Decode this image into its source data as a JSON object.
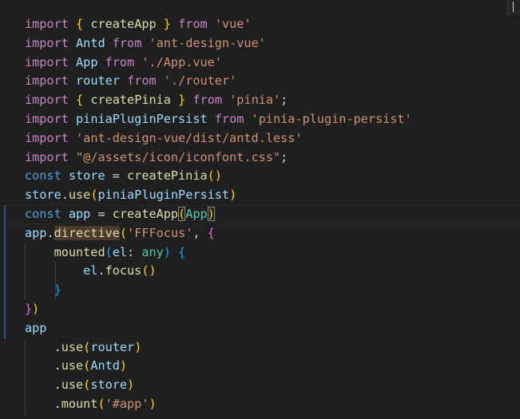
{
  "editor": {
    "language": "typescript",
    "cursor_line": 11,
    "lines": [
      [
        [
          "keyword",
          "import"
        ],
        [
          "plain",
          " "
        ],
        [
          "bracket-1",
          "{"
        ],
        [
          "plain",
          " "
        ],
        [
          "function",
          "createApp"
        ],
        [
          "plain",
          " "
        ],
        [
          "bracket-1",
          "}"
        ],
        [
          "plain",
          " "
        ],
        [
          "keyword",
          "from"
        ],
        [
          "plain",
          " "
        ],
        [
          "string",
          "'vue'"
        ]
      ],
      [
        [
          "keyword",
          "import"
        ],
        [
          "plain",
          " "
        ],
        [
          "variable",
          "Antd"
        ],
        [
          "plain",
          " "
        ],
        [
          "keyword",
          "from"
        ],
        [
          "plain",
          " "
        ],
        [
          "string",
          "'ant-design-vue'"
        ]
      ],
      [
        [
          "keyword",
          "import"
        ],
        [
          "plain",
          " "
        ],
        [
          "variable",
          "App"
        ],
        [
          "plain",
          " "
        ],
        [
          "keyword",
          "from"
        ],
        [
          "plain",
          " "
        ],
        [
          "string",
          "'./App.vue'"
        ]
      ],
      [
        [
          "keyword",
          "import"
        ],
        [
          "plain",
          " "
        ],
        [
          "variable",
          "router"
        ],
        [
          "plain",
          " "
        ],
        [
          "keyword",
          "from"
        ],
        [
          "plain",
          " "
        ],
        [
          "string",
          "'./router'"
        ]
      ],
      [
        [
          "keyword",
          "import"
        ],
        [
          "plain",
          " "
        ],
        [
          "bracket-1",
          "{"
        ],
        [
          "plain",
          " "
        ],
        [
          "function",
          "createPinia"
        ],
        [
          "plain",
          " "
        ],
        [
          "bracket-1",
          "}"
        ],
        [
          "plain",
          " "
        ],
        [
          "keyword",
          "from"
        ],
        [
          "plain",
          " "
        ],
        [
          "string",
          "'pinia'"
        ],
        [
          "plain",
          ";"
        ]
      ],
      [
        [
          "keyword",
          "import"
        ],
        [
          "plain",
          " "
        ],
        [
          "variable",
          "piniaPluginPersist"
        ],
        [
          "plain",
          " "
        ],
        [
          "keyword",
          "from"
        ],
        [
          "plain",
          " "
        ],
        [
          "string",
          "'pinia-plugin-persist'"
        ]
      ],
      [
        [
          "keyword",
          "import"
        ],
        [
          "plain",
          " "
        ],
        [
          "string",
          "'ant-design-vue/dist/antd.less'"
        ]
      ],
      [
        [
          "keyword",
          "import"
        ],
        [
          "plain",
          " "
        ],
        [
          "string",
          "\"@/assets/icon/iconfont.css\""
        ],
        [
          "plain",
          ";"
        ]
      ],
      [
        [
          "storage",
          "const"
        ],
        [
          "plain",
          " "
        ],
        [
          "variable",
          "store"
        ],
        [
          "plain",
          " = "
        ],
        [
          "function",
          "createPinia"
        ],
        [
          "bracket-1",
          "()"
        ]
      ],
      [
        [
          "variable",
          "store"
        ],
        [
          "plain",
          "."
        ],
        [
          "function",
          "use"
        ],
        [
          "bracket-1",
          "("
        ],
        [
          "variable",
          "piniaPluginPersist"
        ],
        [
          "bracket-1",
          ")"
        ]
      ],
      [
        [
          "storage",
          "const"
        ],
        [
          "plain",
          " "
        ],
        [
          "variable",
          "app"
        ],
        [
          "plain",
          " = "
        ],
        [
          "function",
          "createApp"
        ],
        [
          "bracket-1-match",
          "("
        ],
        [
          "type",
          "App"
        ],
        [
          "bracket-1-match",
          ")"
        ]
      ],
      [
        [
          "variable",
          "app"
        ],
        [
          "plain",
          "."
        ],
        [
          "function-highlight",
          "directive"
        ],
        [
          "bracket-1",
          "("
        ],
        [
          "string",
          "'FFFocus'"
        ],
        [
          "plain",
          ", "
        ],
        [
          "bracket-2",
          "{"
        ]
      ],
      [
        [
          "plain",
          "    "
        ],
        [
          "function",
          "mounted"
        ],
        [
          "bracket-3",
          "("
        ],
        [
          "variable",
          "el"
        ],
        [
          "plain",
          ": "
        ],
        [
          "type-any",
          "any"
        ],
        [
          "bracket-3",
          ")"
        ],
        [
          "plain",
          " "
        ],
        [
          "bracket-3",
          "{"
        ]
      ],
      [
        [
          "plain",
          "        "
        ],
        [
          "variable",
          "el"
        ],
        [
          "plain",
          "."
        ],
        [
          "function",
          "focus"
        ],
        [
          "bracket-1",
          "()"
        ]
      ],
      [
        [
          "plain",
          "    "
        ],
        [
          "bracket-3",
          "}"
        ]
      ],
      [
        [
          "bracket-2",
          "}"
        ],
        [
          "bracket-1",
          ")"
        ]
      ],
      [
        [
          "variable",
          "app"
        ]
      ],
      [
        [
          "plain",
          "    ."
        ],
        [
          "function",
          "use"
        ],
        [
          "bracket-1",
          "("
        ],
        [
          "variable",
          "router"
        ],
        [
          "bracket-1",
          ")"
        ]
      ],
      [
        [
          "plain",
          "    ."
        ],
        [
          "function",
          "use"
        ],
        [
          "bracket-1",
          "("
        ],
        [
          "variable",
          "Antd"
        ],
        [
          "bracket-1",
          ")"
        ]
      ],
      [
        [
          "plain",
          "    ."
        ],
        [
          "function",
          "use"
        ],
        [
          "bracket-1",
          "("
        ],
        [
          "variable",
          "store"
        ],
        [
          "bracket-1",
          ")"
        ]
      ],
      [
        [
          "plain",
          "    ."
        ],
        [
          "function",
          "mount"
        ],
        [
          "bracket-1",
          "("
        ],
        [
          "string",
          "'#app'"
        ],
        [
          "bracket-1",
          ")"
        ]
      ]
    ]
  }
}
